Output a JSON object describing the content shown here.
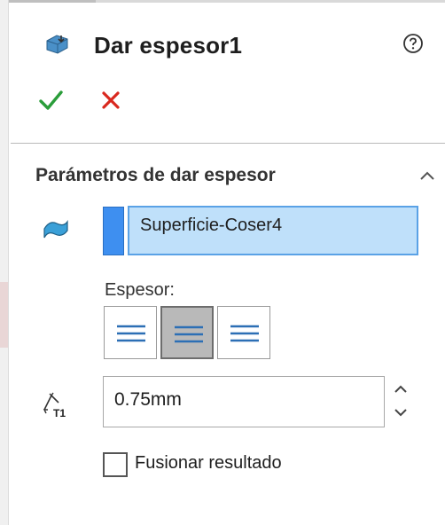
{
  "header": {
    "title": "Dar espesor1"
  },
  "section": {
    "title": "Parámetros de dar espesor"
  },
  "selection": {
    "value": "Superficie-Coser4"
  },
  "thickness": {
    "label": "Espesor:",
    "side_options": [
      "side-1",
      "both-sides",
      "side-2"
    ],
    "selected_option": "both-sides",
    "value": "0.75mm"
  },
  "merge": {
    "label": "Fusionar resultado",
    "checked": false
  },
  "colors": {
    "accept": "#2a9d3a",
    "cancel": "#d9281e",
    "swatch": "#3e8ff0",
    "selection_bg": "#bfe0fa"
  }
}
